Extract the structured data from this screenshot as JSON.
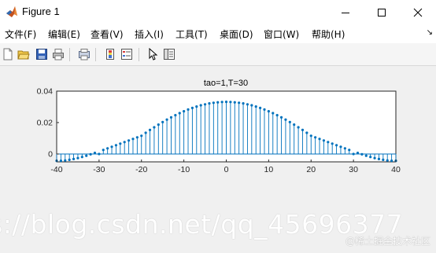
{
  "window": {
    "title": "Figure 1"
  },
  "menu": [
    {
      "label": "文件(F)"
    },
    {
      "label": "编辑(E)"
    },
    {
      "label": "查看(V)"
    },
    {
      "label": "插入(I)"
    },
    {
      "label": "工具(T)"
    },
    {
      "label": "桌面(D)"
    },
    {
      "label": "窗口(W)"
    },
    {
      "label": "帮助(H)"
    }
  ],
  "toolbar": {
    "icons": [
      "new-figure-icon",
      "open-file-icon",
      "save-icon",
      "print-icon",
      "print-preview-icon",
      "colorbar-icon",
      "legend-icon",
      "pointer-icon",
      "property-editor-icon"
    ]
  },
  "chart_data": {
    "type": "stem",
    "title": "tao=1,T=30",
    "xlabel": "",
    "ylabel": "",
    "xlim": [
      -40,
      40
    ],
    "ylim": [
      -0.005,
      0.04
    ],
    "xticks": [
      "-40",
      "-30",
      "-20",
      "-10",
      "0",
      "10",
      "20",
      "30",
      "40"
    ],
    "yticks": [
      "0",
      "0.02",
      "0.04"
    ],
    "grid": false,
    "color": "#0072bd",
    "x": [
      -40,
      -39,
      -38,
      -37,
      -36,
      -35,
      -34,
      -33,
      -32,
      -31,
      -30,
      -29,
      -28,
      -27,
      -26,
      -25,
      -24,
      -23,
      -22,
      -21,
      -20,
      -19,
      -18,
      -17,
      -16,
      -15,
      -14,
      -13,
      -12,
      -11,
      -10,
      -9,
      -8,
      -7,
      -6,
      -5,
      -4,
      -3,
      -2,
      -1,
      0,
      1,
      2,
      3,
      4,
      5,
      6,
      7,
      8,
      9,
      10,
      11,
      12,
      13,
      14,
      15,
      16,
      17,
      18,
      19,
      20,
      21,
      22,
      23,
      24,
      25,
      26,
      27,
      28,
      29,
      30,
      31,
      32,
      33,
      34,
      35,
      36,
      37,
      38,
      39,
      40
    ],
    "y": [
      -0.0043,
      -0.0043,
      -0.0041,
      -0.0037,
      -0.0032,
      -0.0026,
      -0.0019,
      -0.0011,
      -0.0002,
      0.0007,
      0.0,
      0.0026,
      0.0036,
      0.0046,
      0.0056,
      0.0066,
      0.0076,
      0.0086,
      0.0096,
      0.0106,
      0.0116,
      0.0135,
      0.0153,
      0.017,
      0.0187,
      0.0203,
      0.0219,
      0.0233,
      0.0247,
      0.026,
      0.0272,
      0.0283,
      0.0293,
      0.0302,
      0.031,
      0.0316,
      0.0322,
      0.0326,
      0.0329,
      0.0331,
      0.0332,
      0.0331,
      0.0329,
      0.0326,
      0.0322,
      0.0316,
      0.031,
      0.0302,
      0.0293,
      0.0283,
      0.0272,
      0.026,
      0.0247,
      0.0233,
      0.0219,
      0.0203,
      0.0187,
      0.017,
      0.0153,
      0.0135,
      0.0116,
      0.0106,
      0.0096,
      0.0086,
      0.0076,
      0.0066,
      0.0056,
      0.0046,
      0.0036,
      0.0026,
      0.0,
      0.0007,
      -0.0002,
      -0.0011,
      -0.0019,
      -0.0026,
      -0.0032,
      -0.0037,
      -0.0041,
      -0.0043,
      -0.0043
    ]
  },
  "watermark": {
    "text": "s://blog.csdn.net/qq_45696377",
    "credit": "@稀土掘金技术社区"
  }
}
